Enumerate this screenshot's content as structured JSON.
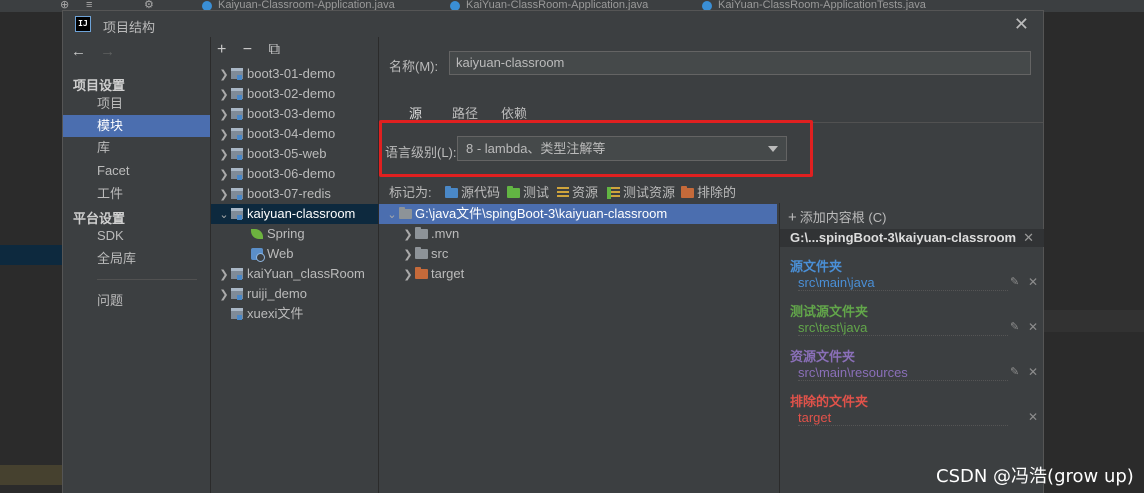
{
  "background": {
    "tabs": [
      "Kaiyuan-Classroom-Application.java",
      "KaiYuan-ClassRoom-Application.java",
      "KaiYuan-ClassRoom-ApplicationTests.java"
    ]
  },
  "dialog": {
    "title": "项目结构",
    "logo_text": "IJ",
    "close_icon": "close-icon"
  },
  "nav": {
    "back": "←",
    "forward": "→",
    "project_settings_header": "项目设置",
    "project_settings": [
      "项目",
      "模块",
      "库",
      "Facet",
      "工件"
    ],
    "platform_settings_header": "平台设置",
    "platform_settings": [
      "SDK",
      "全局库"
    ],
    "problems": "问题",
    "selected": "模块"
  },
  "module_tree": {
    "toolbar": [
      "+",
      "−",
      "⧉"
    ],
    "items": [
      {
        "label": "boot3-01-demo"
      },
      {
        "label": "boot3-02-demo"
      },
      {
        "label": "boot3-03-demo"
      },
      {
        "label": "boot3-04-demo"
      },
      {
        "label": "boot3-05-web"
      },
      {
        "label": "boot3-06-demo"
      },
      {
        "label": "boot3-07-redis"
      },
      {
        "label": "kaiyuan-classroom"
      },
      {
        "label": "Spring"
      },
      {
        "label": "Web"
      },
      {
        "label": "kaiYuan_classRoom"
      },
      {
        "label": "ruiji_demo"
      },
      {
        "label": "xuexi文件"
      }
    ],
    "selected": "kaiyuan-classroom"
  },
  "module": {
    "name_label": "名称(M):",
    "name_value": "kaiyuan-classroom",
    "tabs": [
      "源",
      "路径",
      "依赖"
    ],
    "active_tab": "源",
    "language_level_label": "语言级别(L):",
    "language_level_value": "8 - lambda、类型注解等",
    "mark_as_label": "标记为:",
    "mark_as": [
      "源代码",
      "测试",
      "资源",
      "测试资源",
      "排除的"
    ]
  },
  "file_tree": {
    "root": "G:\\java文件\\spingBoot-3\\kaiyuan-classroom",
    "children": [
      ".mvn",
      "src",
      "target"
    ]
  },
  "content_root": {
    "add_label": "添加内容根",
    "add_shortcut": "(C)",
    "root_path": "G:\\...spingBoot-3\\kaiyuan-classroom",
    "groups": [
      {
        "title": "源文件夹",
        "path": "src\\main\\java",
        "color": "#4a8fd6"
      },
      {
        "title": "测试源文件夹",
        "path": "src\\test\\java",
        "color": "#62a64a"
      },
      {
        "title": "资源文件夹",
        "path": "src\\main\\resources",
        "color": "#8a6fb8"
      },
      {
        "title": "排除的文件夹",
        "path": "target",
        "color": "#e0524a"
      }
    ]
  },
  "watermark": "CSDN @冯浩(grow up)",
  "colors": {
    "accent": "#4b6eaf",
    "highlight_box": "#e02020"
  }
}
